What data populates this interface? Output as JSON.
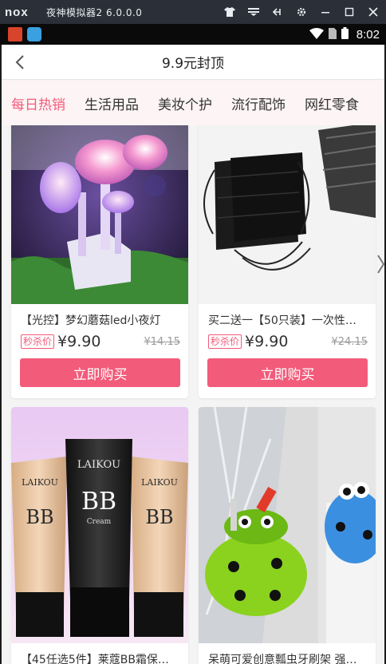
{
  "emulator": {
    "logo": "nox",
    "title": "夜神模拟器2 6.0.0.0"
  },
  "status_bar": {
    "time": "8:02"
  },
  "header": {
    "title": "9.9元封顶"
  },
  "tabs": [
    {
      "label": "每日热销",
      "active": true
    },
    {
      "label": "生活用品",
      "active": false
    },
    {
      "label": "美妆个护",
      "active": false
    },
    {
      "label": "流行配饰",
      "active": false
    },
    {
      "label": "网红零食",
      "active": false
    }
  ],
  "products": [
    {
      "title": "【光控】梦幻蘑菇led小夜灯",
      "tag": "秒杀价",
      "price": "¥9.90",
      "original_price": "¥14.15",
      "buy_label": "立即购买"
    },
    {
      "title": "买二送一【50只装】一次性…",
      "tag": "秒杀价",
      "price": "¥9.90",
      "original_price": "¥24.15",
      "buy_label": "立即购买"
    },
    {
      "title": "【45任选5件】莱蔻BB霜保…"
    },
    {
      "title": "呆萌可爱创意瓢虫牙刷架 强…"
    }
  ],
  "product_images": {
    "bb_brand": "LAIKOU",
    "bb_label": "BB",
    "bb_sub": "Cream"
  },
  "colors": {
    "accent": "#f25b7a",
    "tab_bg": "#fdf4f5"
  }
}
